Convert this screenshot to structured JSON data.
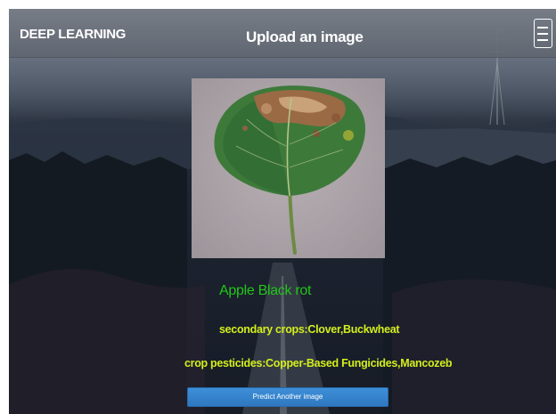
{
  "header": {
    "brand": "DEEP LEARNING",
    "title": "Upload an image",
    "menu_icon": "hamburger-menu-icon"
  },
  "upload": {
    "image_subject": "leaf-photo"
  },
  "result": {
    "disease": "Apple Black rot",
    "secondary_crops": "secondary crops:Clover,Buckwheat",
    "crop_pesticides": "crop pesticides:Copper-Based Fungicides,Mancozeb"
  },
  "actions": {
    "predict_again_label": "Predict Another image"
  },
  "colors": {
    "disease_text": "#22c51a",
    "info_text": "#d3ee1c",
    "button": "#3585cc",
    "header": "#707680"
  }
}
